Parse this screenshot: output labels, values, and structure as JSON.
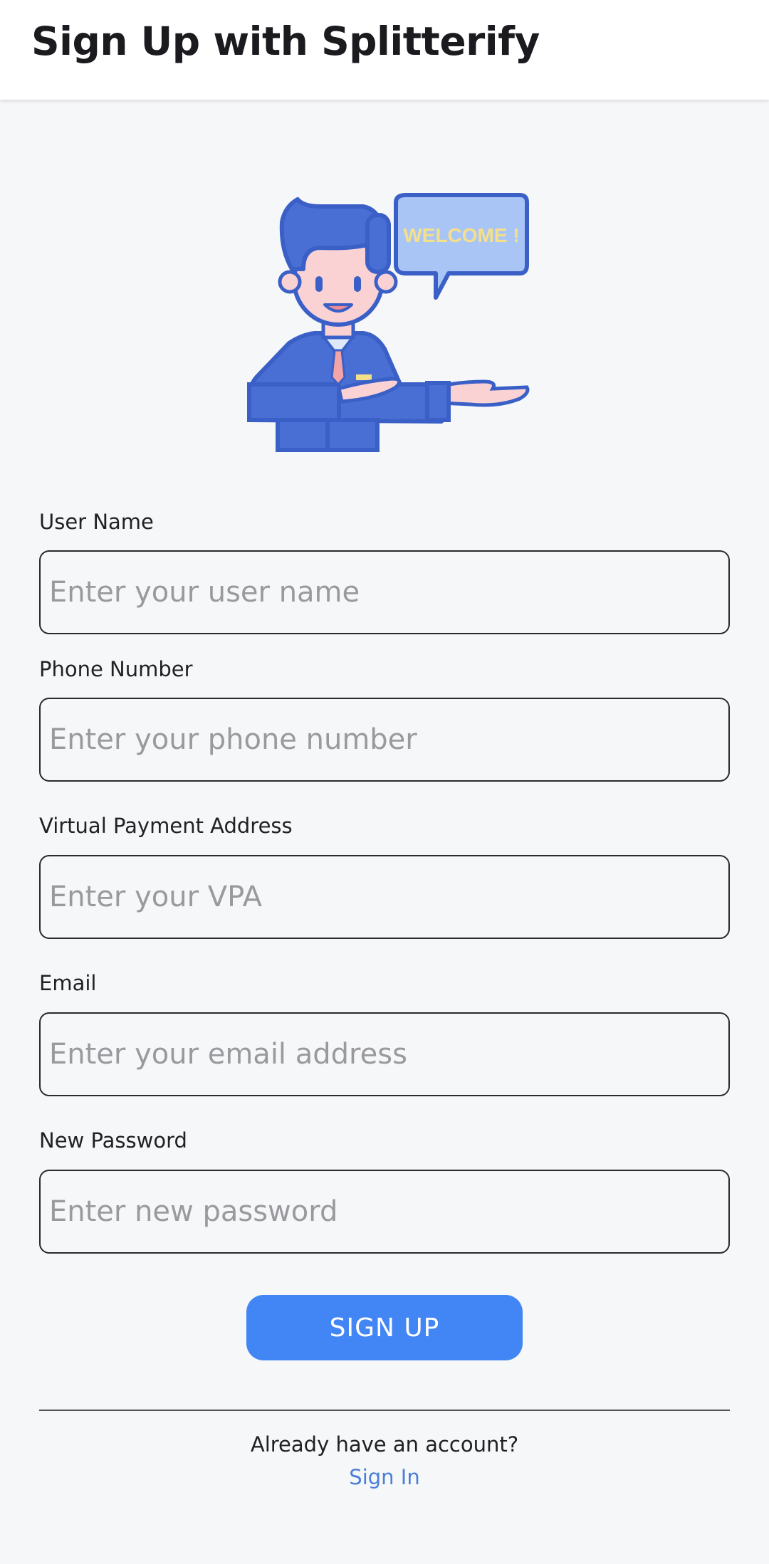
{
  "appbar": {
    "title": "Sign Up with Splitterify"
  },
  "illustration": {
    "speech_bubble": "WELCOME !",
    "icon": "welcome-man-icon"
  },
  "form": {
    "fields": [
      {
        "label": "User Name",
        "placeholder": "Enter your user name",
        "value": ""
      },
      {
        "label": "Phone Number",
        "placeholder": "Enter your phone number",
        "value": ""
      },
      {
        "label": "Virtual Payment Address",
        "placeholder": "Enter your VPA",
        "value": ""
      },
      {
        "label": "Email",
        "placeholder": "Enter your email address",
        "value": ""
      },
      {
        "label": "New Password",
        "placeholder": "Enter new password",
        "value": ""
      }
    ],
    "submit_label": "SIGN UP"
  },
  "footer": {
    "account_prompt": "Already have an account?",
    "signin_label": "Sign In"
  },
  "colors": {
    "primary": "#4285f4",
    "link": "#4a7fd8",
    "background": "#f6f7f9",
    "illustration_blue": "#4a6fd4",
    "bubble_text": "#f5e08a"
  }
}
